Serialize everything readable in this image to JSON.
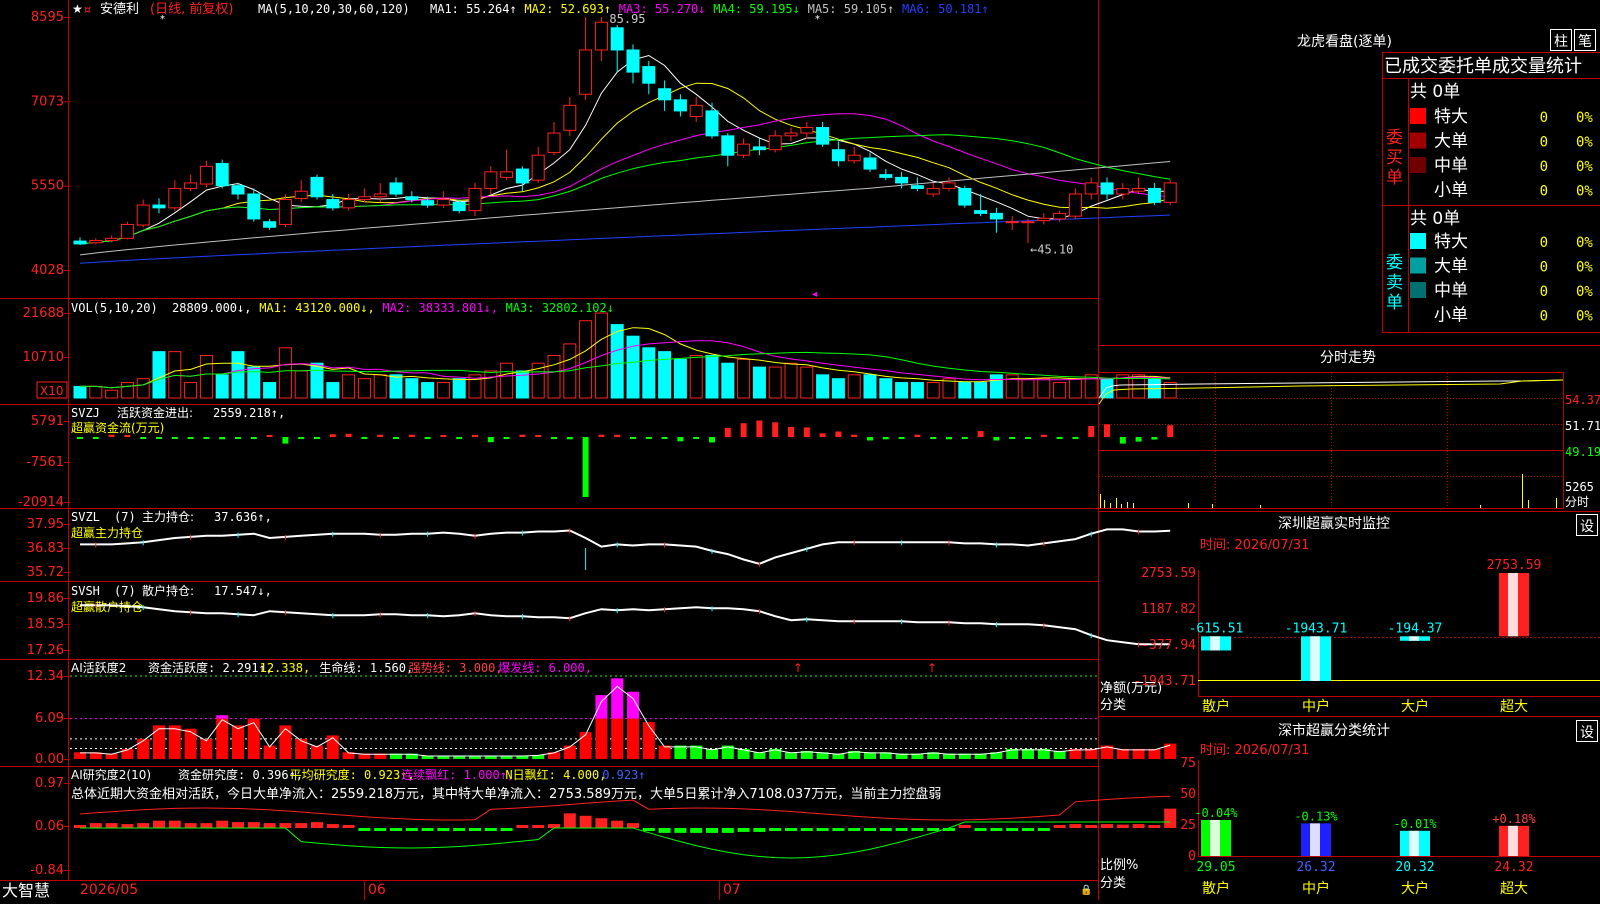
{
  "stock": {
    "name": "安德利",
    "mode": "(日线, 前复权)",
    "ma_text": "MA(5,10,20,30,60,120)",
    "ma_items": [
      {
        "label": "MA1: 55.264↑",
        "color": "#ffffff"
      },
      {
        "label": "MA2: 52.693↑",
        "color": "#ffff00"
      },
      {
        "label": "MA3: 55.270↓",
        "color": "#ff00ff"
      },
      {
        "label": "MA4: 59.195↓",
        "color": "#00ff00"
      },
      {
        "label": "MA5: 59.105↑",
        "color": "#c0c0c0"
      },
      {
        "label": "MA6: 50.181↑",
        "color": "#2040ff"
      }
    ],
    "high_label": "85.95",
    "low_label": "←45.10"
  },
  "logo": "大智慧",
  "dates": [
    "2026/05",
    "06",
    "07"
  ],
  "panels": {
    "main": {
      "yticks": [
        "8595",
        "7073",
        "5550",
        "4028"
      ],
      "candles": [
        [
          45.5,
          45.0,
          46.2,
          44.8
        ],
        [
          45.2,
          45.6,
          46.0,
          44.9
        ],
        [
          45.6,
          46.0,
          46.5,
          45.3
        ],
        [
          46.0,
          48.5,
          49.0,
          45.8
        ],
        [
          48.4,
          52.0,
          53.0,
          48.0
        ],
        [
          52.0,
          51.5,
          53.2,
          50.5
        ],
        [
          51.5,
          55.0,
          56.5,
          51.0
        ],
        [
          55.0,
          56.0,
          57.5,
          54.5
        ],
        [
          55.8,
          59.0,
          60.0,
          55.2
        ],
        [
          59.5,
          55.5,
          60.2,
          55.0
        ],
        [
          55.5,
          54.0,
          56.0,
          53.0
        ],
        [
          54.0,
          49.5,
          55.0,
          49.0
        ],
        [
          49.0,
          48.0,
          49.5,
          47.5
        ],
        [
          48.5,
          53.0,
          54.0,
          48.0
        ],
        [
          53.2,
          54.5,
          56.5,
          52.5
        ],
        [
          57.0,
          53.5,
          57.5,
          53.0
        ],
        [
          53.0,
          51.5,
          54.0,
          51.0
        ],
        [
          51.5,
          53.0,
          54.0,
          51.0
        ],
        [
          53.0,
          53.5,
          55.0,
          52.5
        ],
        [
          53.5,
          54.0,
          56.0,
          52.5
        ],
        [
          56.0,
          54.0,
          57.0,
          53.5
        ],
        [
          53.5,
          53.0,
          54.5,
          52.5
        ],
        [
          52.8,
          52.0,
          53.5,
          51.5
        ],
        [
          52.0,
          53.0,
          54.5,
          51.5
        ],
        [
          52.5,
          51.0,
          53.0,
          50.5
        ],
        [
          51.0,
          55.0,
          56.0,
          50.0
        ],
        [
          55.0,
          58.0,
          59.0,
          54.0
        ],
        [
          57.0,
          58.0,
          62.0,
          56.5
        ],
        [
          58.5,
          56.0,
          59.0,
          54.5
        ],
        [
          56.5,
          61.0,
          62.5,
          56.0
        ],
        [
          61.5,
          65.0,
          67.0,
          61.0
        ],
        [
          65.5,
          70.0,
          71.5,
          64.5
        ],
        [
          72.0,
          80.0,
          85.95,
          71.0
        ],
        [
          80.0,
          85.0,
          85.95,
          78.0
        ],
        [
          84.0,
          80.0,
          84.5,
          76.0
        ],
        [
          80.0,
          76.0,
          81.0,
          74.0
        ],
        [
          77.0,
          74.0,
          78.0,
          72.0
        ],
        [
          73.0,
          71.0,
          74.5,
          69.0
        ],
        [
          71.0,
          69.0,
          72.0,
          68.0
        ],
        [
          68.0,
          70.0,
          71.5,
          67.0
        ],
        [
          69.0,
          64.5,
          70.5,
          64.0
        ],
        [
          64.5,
          61.0,
          65.0,
          59.0
        ],
        [
          61.0,
          63.0,
          64.0,
          60.5
        ],
        [
          62.5,
          62.0,
          64.0,
          61.0
        ],
        [
          62.0,
          64.5,
          65.5,
          61.5
        ],
        [
          64.5,
          65.0,
          66.0,
          63.5
        ],
        [
          65.0,
          66.0,
          67.0,
          64.0
        ],
        [
          66.0,
          63.0,
          67.0,
          62.5
        ],
        [
          62.0,
          60.0,
          63.5,
          59.0
        ],
        [
          60.0,
          61.0,
          62.5,
          59.5
        ],
        [
          60.5,
          58.5,
          61.5,
          58.0
        ],
        [
          57.5,
          57.0,
          58.5,
          56.5
        ],
        [
          57.0,
          56.0,
          58.0,
          55.0
        ],
        [
          55.5,
          55.0,
          57.0,
          54.5
        ],
        [
          54.0,
          55.0,
          56.0,
          53.5
        ],
        [
          55.0,
          56.0,
          57.0,
          54.5
        ],
        [
          55.0,
          52.0,
          55.5,
          51.5
        ],
        [
          51.0,
          50.5,
          54.0,
          50.0
        ],
        [
          50.5,
          49.5,
          51.5,
          47.0
        ],
        [
          49.0,
          49.0,
          50.0,
          47.5
        ],
        [
          49.0,
          49.0,
          49.5,
          45.1
        ],
        [
          49.2,
          49.6,
          50.5,
          48.5
        ],
        [
          49.5,
          50.5,
          51.0,
          49.0
        ],
        [
          50.0,
          54.0,
          55.0,
          49.5
        ],
        [
          54.0,
          56.0,
          57.0,
          53.0
        ],
        [
          56.0,
          54.0,
          57.0,
          53.0
        ],
        [
          54.0,
          55.0,
          56.0,
          53.0
        ],
        [
          54.5,
          55.0,
          57.0,
          54.0
        ],
        [
          55.0,
          52.5,
          56.0,
          52.0
        ],
        [
          52.5,
          56.0,
          56.5,
          52.0
        ]
      ]
    },
    "vol": {
      "header": "VOL(5,10,20)",
      "header_items": [
        {
          "label": "28809.000↓,",
          "color": "#ffffff"
        },
        {
          "label": "MA1: 43120.000↓,",
          "color": "#ffff00"
        },
        {
          "label": "MA2: 38333.801↓,",
          "color": "#ff00ff"
        },
        {
          "label": "MA3: 32802.102↓",
          "color": "#00ff00"
        }
      ],
      "yticks": [
        "21688",
        "10710"
      ],
      "unit": "X10",
      "values": [
        3,
        3,
        2,
        4,
        5,
        12,
        12,
        4,
        11,
        6,
        12,
        8,
        4,
        13,
        7,
        9,
        4,
        6,
        5,
        6,
        6,
        5,
        4,
        4,
        5,
        6,
        7,
        9,
        7,
        9,
        11,
        14,
        20,
        22,
        19,
        16,
        13,
        12,
        10,
        11,
        11,
        9,
        10,
        8,
        8,
        9,
        8,
        6,
        5,
        6,
        6,
        5,
        4,
        4,
        4,
        5,
        4,
        4,
        6,
        6,
        5,
        5,
        4,
        5,
        6,
        5,
        6,
        6,
        5,
        4
      ]
    },
    "flow": {
      "header": "SVZJ",
      "header_label": "活跃资金进出:",
      "header_value": "2559.218↑,",
      "subtitle": "超赢资金流(万元)",
      "yticks": [
        "5791",
        "-7561",
        "-20914"
      ],
      "values": [
        -400,
        -300,
        500,
        300,
        -500,
        -400,
        -400,
        -500,
        -600,
        -800,
        -500,
        -500,
        400,
        -2300,
        -300,
        -400,
        600,
        700,
        -300,
        500,
        -400,
        500,
        -300,
        400,
        -700,
        300,
        -1800,
        -600,
        500,
        300,
        -400,
        -800,
        -20914,
        500,
        500,
        -300,
        -400,
        -700,
        -1500,
        -600,
        -1900,
        2000,
        3000,
        3600,
        3200,
        2200,
        2100,
        800,
        1200,
        500,
        -1200,
        -800,
        -700,
        500,
        -600,
        -800,
        -500,
        1300,
        -1200,
        -700,
        -400,
        500,
        -300,
        -500,
        2400,
        2800,
        -2300,
        -1600,
        -900,
        2559
      ]
    },
    "hold": {
      "header": "SVZL",
      "header_param": "(7)",
      "header_label": "主力持仓:",
      "header_value": "37.636↑,",
      "subtitle": "超赢主力持仓",
      "yticks": [
        "37.95",
        "36.83",
        "35.72"
      ],
      "values": [
        37.0,
        37.0,
        37.0,
        37.05,
        37.1,
        37.2,
        37.3,
        37.35,
        37.4,
        37.4,
        37.45,
        37.5,
        37.3,
        37.35,
        37.4,
        37.45,
        37.5,
        37.5,
        37.5,
        37.45,
        37.45,
        37.5,
        37.5,
        37.55,
        37.5,
        37.4,
        37.5,
        37.55,
        37.55,
        37.6,
        37.6,
        37.65,
        37.3,
        36.9,
        37.0,
        36.95,
        37.0,
        37.0,
        36.95,
        36.9,
        36.7,
        36.55,
        36.3,
        36.1,
        36.4,
        36.6,
        36.8,
        37.0,
        37.1,
        37.1,
        37.1,
        37.1,
        37.1,
        37.1,
        37.1,
        37.1,
        37.05,
        37.05,
        37.0,
        37.0,
        36.95,
        37.05,
        37.15,
        37.25,
        37.5,
        37.7,
        37.7,
        37.6,
        37.6,
        37.636
      ]
    },
    "retail": {
      "header": "SVSH",
      "header_param": "(7)",
      "header_label": "散户持仓:",
      "header_value": "17.547↓,",
      "subtitle": "超赢散户持仓",
      "yticks": [
        "19.86",
        "18.53",
        "17.26"
      ],
      "values": [
        19.5,
        19.5,
        19.5,
        19.45,
        19.4,
        19.3,
        19.2,
        19.15,
        19.1,
        19.1,
        19.05,
        19.0,
        19.2,
        19.15,
        19.1,
        19.05,
        19.0,
        19.0,
        19.0,
        19.05,
        19.05,
        19.0,
        19.0,
        18.95,
        19.0,
        19.1,
        19.0,
        18.95,
        18.95,
        18.9,
        18.9,
        18.85,
        19.1,
        19.3,
        19.25,
        19.3,
        19.25,
        19.3,
        19.35,
        19.4,
        19.35,
        19.35,
        19.3,
        19.2,
        18.95,
        18.75,
        18.8,
        18.75,
        18.7,
        18.7,
        18.7,
        18.7,
        18.7,
        18.65,
        18.65,
        18.65,
        18.6,
        18.6,
        18.55,
        18.55,
        18.55,
        18.5,
        18.4,
        18.3,
        18.0,
        17.75,
        17.65,
        17.55,
        17.55,
        17.547
      ]
    },
    "ai_active": {
      "header": "AI活跃度2",
      "header_items": [
        {
          "label": "资金活跃度: 2.291↑,",
          "color": "#ffffff"
        },
        {
          "label": "12.338,",
          "color": "#ffff00"
        },
        {
          "label": "生命线: 1.560,",
          "color": "#ffffff"
        },
        {
          "label": "强势线: 3.000,",
          "color": "#ff4040"
        },
        {
          "label": "爆发线: 6.000,",
          "color": "#ff00ff"
        }
      ],
      "yticks": [
        "12.34",
        "6.09",
        "0.00"
      ],
      "values": [
        1.0,
        1.0,
        0.8,
        1.5,
        3.0,
        5.0,
        5.0,
        4.5,
        3.0,
        6.5,
        5.0,
        6.0,
        2.0,
        5.0,
        3.0,
        2.0,
        3.5,
        1.0,
        0.8,
        0.8,
        0.8,
        0.8,
        0.5,
        0.5,
        0.5,
        0.5,
        0.5,
        0.5,
        0.5,
        0.6,
        1.0,
        2.0,
        4.0,
        9.5,
        12.0,
        10.0,
        5.5,
        2.0,
        2.0,
        2.0,
        1.5,
        2.0,
        1.5,
        1.0,
        1.5,
        1.0,
        1.2,
        1.0,
        0.8,
        1.2,
        1.0,
        1.0,
        0.8,
        0.8,
        1.0,
        0.8,
        0.8,
        0.8,
        1.0,
        1.5,
        1.5,
        1.5,
        1.2,
        1.5,
        1.5,
        2.0,
        1.5,
        1.5,
        1.5,
        2.291
      ],
      "magenta_over": 6.0
    },
    "ai_research": {
      "header": "AI研究度2(10)",
      "header_items": [
        {
          "label": "资金研究度: 0.396↑,",
          "color": "#ffffff"
        },
        {
          "label": "平均研究度: 0.923↑,",
          "color": "#ffff00"
        },
        {
          "label": "连续飘红: 1.000↑,",
          "color": "#ff00ff"
        },
        {
          "label": "N日飘红: 4.000,",
          "color": "#ffff00"
        },
        {
          "label": "0.923↑",
          "color": "#4060ff"
        }
      ],
      "summary": "总体近期大资金相对活跃，今日大单净流入：2559.218万元，其中特大单净流入：2753.589万元，大单5日累计净入7108.037万元，当前主力控盘弱",
      "yticks": [
        "0.97",
        "0.06",
        "-0.84"
      ],
      "values": [
        0.05,
        0.1,
        0.1,
        0.08,
        0.1,
        0.15,
        0.15,
        0.1,
        0.1,
        0.15,
        0.12,
        0.12,
        0.1,
        0.1,
        0.1,
        0.12,
        0.08,
        0.05,
        -0.03,
        -0.05,
        -0.06,
        -0.05,
        -0.03,
        -0.03,
        -0.04,
        -0.03,
        -0.03,
        -0.02,
        0.05,
        0.05,
        0.08,
        0.3,
        0.25,
        0.2,
        0.15,
        0.1,
        -0.05,
        -0.1,
        -0.1,
        -0.1,
        -0.1,
        -0.1,
        -0.08,
        -0.08,
        -0.05,
        -0.03,
        -0.05,
        -0.05,
        -0.05,
        -0.05,
        -0.05,
        -0.05,
        -0.05,
        -0.06,
        -0.06,
        -0.05,
        0.03,
        -0.05,
        -0.05,
        -0.05,
        -0.04,
        -0.05,
        0.05,
        0.08,
        0.05,
        0.08,
        0.07,
        0.08,
        0.05,
        0.396
      ]
    }
  },
  "dragon": {
    "title": "龙虎看盘(逐单)",
    "btn_bar": "柱",
    "btn_stroke": "笔",
    "section_title": "已成交委托单成交量统计",
    "buy": {
      "label": "委买单",
      "total": "共 0单",
      "rows": [
        {
          "name": "特大",
          "value": "0",
          "pct": "0%",
          "color": "#ff0000"
        },
        {
          "name": "大单",
          "value": "0",
          "pct": "0%",
          "color": "#a00000"
        },
        {
          "name": "中单",
          "value": "0",
          "pct": "0%",
          "color": "#700000"
        },
        {
          "name": "小单",
          "value": "0",
          "pct": "0%",
          "color": "#000000"
        }
      ]
    },
    "sell": {
      "label": "委卖单",
      "total": "共 0单",
      "rows": [
        {
          "name": "特大",
          "value": "0",
          "pct": "0%",
          "color": "#00ffff"
        },
        {
          "name": "大单",
          "value": "0",
          "pct": "0%",
          "color": "#00a0a0"
        },
        {
          "name": "中单",
          "value": "0",
          "pct": "0%",
          "color": "#007070"
        },
        {
          "name": "小单",
          "value": "0",
          "pct": "0%",
          "color": "#000000"
        }
      ]
    }
  },
  "minute": {
    "title": "分时走势",
    "yticks": [
      "54.37",
      "51.71",
      "49.19"
    ],
    "vol_tick": "5265",
    "vol_unit": "分时"
  },
  "monitor": {
    "title": "深圳超赢实时监控",
    "set": "设",
    "time": "时间: 2026/07/31",
    "yticks": [
      "2753.59",
      "1187.82",
      "-377.94",
      "-1943.71"
    ],
    "ylabel": "净额(万元)",
    "xlabel_title": "分类",
    "categories": [
      "散户",
      "中户",
      "大户",
      "超大"
    ],
    "values": [
      -615.51,
      -1943.71,
      -194.37,
      2753.59
    ],
    "value_labels": [
      "-615.51",
      "-1943.71",
      "-194.37",
      "2753.59"
    ],
    "colors": [
      "#00ffff",
      "#00ffff",
      "#00ffff",
      "#ff2020"
    ]
  },
  "classify": {
    "title": "深市超赢分类统计",
    "set": "设",
    "time": "时间: 2026/07/31",
    "yticks": [
      "75",
      "50",
      "25",
      "0"
    ],
    "ylabel": "比例%",
    "xlabel_title": "分类",
    "categories": [
      "散户",
      "中户",
      "大户",
      "超大"
    ],
    "values": [
      29.05,
      26.32,
      20.32,
      24.32
    ],
    "changes": [
      "-0.04%",
      "-0.13%",
      "-0.01%",
      "+0.18%"
    ],
    "change_colors": [
      "#00ff00",
      "#00ff00",
      "#00ff00",
      "#ff4040"
    ],
    "value_labels": [
      "29.05",
      "26.32",
      "20.32",
      "24.32"
    ],
    "colors": [
      "#00ff00",
      "#2020ff",
      "#00ffff",
      "#ff2020"
    ]
  },
  "chart_data": [
    {
      "type": "candlestick",
      "title": "安德利 (日线, 前复权)",
      "yticks": [
        "8595",
        "7073",
        "5550",
        "4028"
      ],
      "high": 85.95,
      "low": 45.1,
      "moving_averages": {
        "MA1": 55.264,
        "MA2": 52.693,
        "MA3": 55.27,
        "MA4": 59.195,
        "MA5": 59.105,
        "MA6": 50.181
      }
    },
    {
      "type": "bar",
      "title": "深圳超赢实时监控",
      "categories": [
        "散户",
        "中户",
        "大户",
        "超大"
      ],
      "values": [
        -615.51,
        -1943.71,
        -194.37,
        2753.59
      ],
      "ylabel": "净额(万元)",
      "ylim": [
        -1943.71,
        2753.59
      ]
    },
    {
      "type": "bar",
      "title": "深市超赢分类统计",
      "categories": [
        "散户",
        "中户",
        "大户",
        "超大"
      ],
      "values": [
        29.05,
        26.32,
        20.32,
        24.32
      ],
      "ylabel": "比例%",
      "ylim": [
        0,
        75
      ]
    }
  ]
}
